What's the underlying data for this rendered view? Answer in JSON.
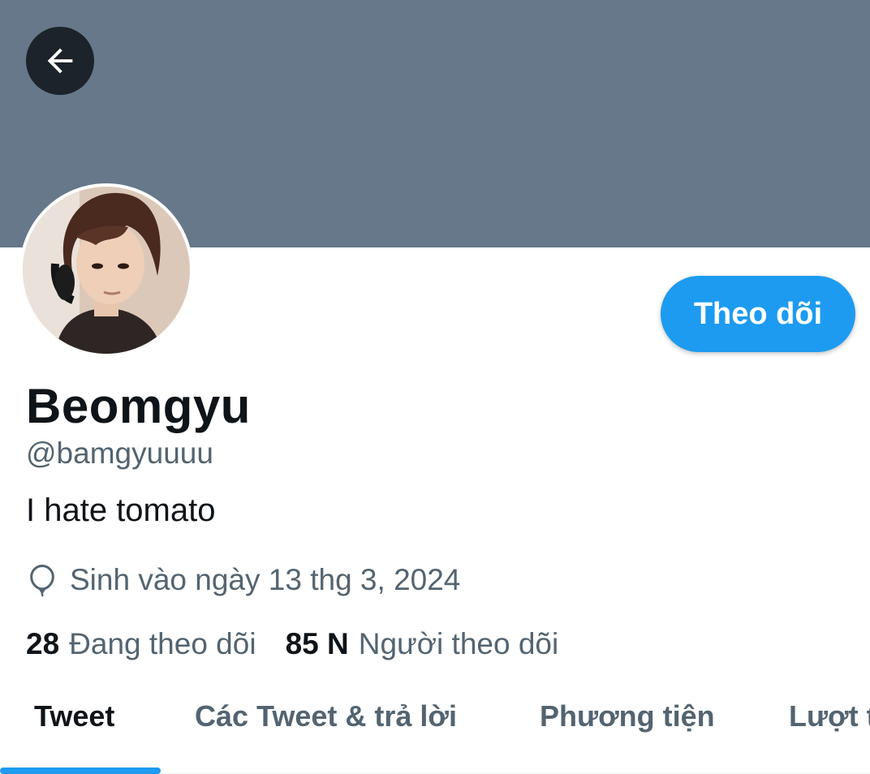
{
  "colors": {
    "banner": "#66788a",
    "accent": "#1d9bf0",
    "text_primary": "#0f1419",
    "text_secondary": "#536471"
  },
  "header": {
    "back_icon": "arrow-left-icon"
  },
  "profile": {
    "follow_label": "Theo dõi",
    "display_name": "Beomgyu",
    "handle": "@bamgyuuuu",
    "bio": "I hate tomato",
    "birth_icon": "balloon-icon",
    "birth_text": "Sinh vào ngày 13 thg 3, 2024",
    "following_count": "28",
    "following_label": "Đang theo dõi",
    "followers_count": "85 N",
    "followers_label": "Người theo dõi"
  },
  "tabs": [
    {
      "label": "Tweet",
      "active": true
    },
    {
      "label": "Các Tweet & trả lời",
      "active": false
    },
    {
      "label": "Phương tiện",
      "active": false
    },
    {
      "label": "Lượt thích",
      "active": false
    }
  ]
}
